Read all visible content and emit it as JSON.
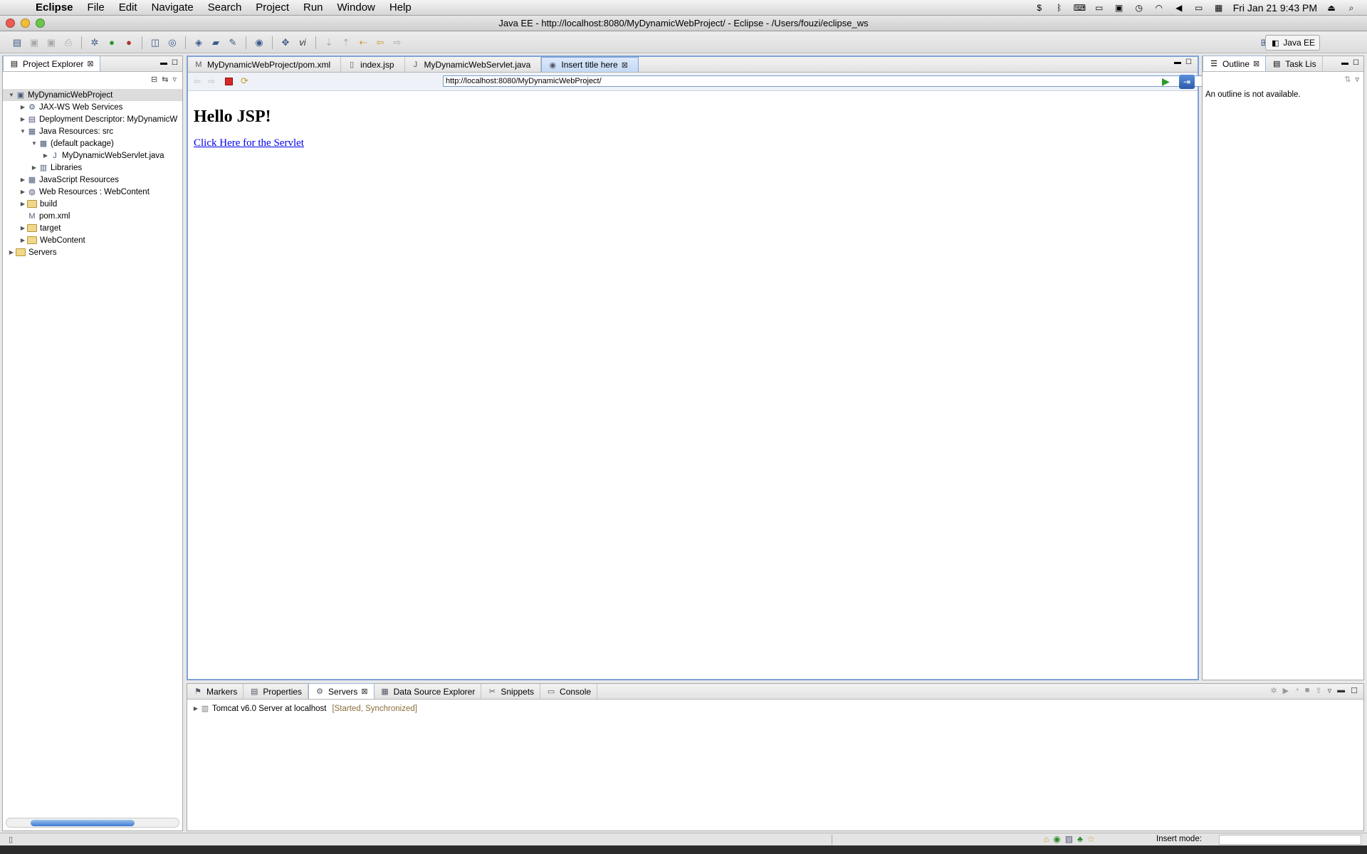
{
  "menubar": {
    "app": "Eclipse",
    "items": [
      "File",
      "Edit",
      "Navigate",
      "Search",
      "Project",
      "Run",
      "Window",
      "Help"
    ],
    "clock": "Fri Jan 21  9:43 PM"
  },
  "window": {
    "title": "Java EE - http://localhost:8080/MyDynamicWebProject/ - Eclipse - /Users/fouzi/eclipse_ws"
  },
  "perspective": {
    "label": "Java EE"
  },
  "project_explorer": {
    "tab_label": "Project Explorer",
    "tree": [
      {
        "label": "MyDynamicWebProject",
        "depth": 0,
        "expander": "open",
        "icon": "project-icon"
      },
      {
        "label": "JAX-WS Web Services",
        "depth": 1,
        "expander": "closed",
        "icon": "webservice-icon"
      },
      {
        "label": "Deployment Descriptor: MyDynamicW",
        "depth": 1,
        "expander": "closed",
        "icon": "descriptor-icon"
      },
      {
        "label": "Java Resources: src",
        "depth": 1,
        "expander": "open",
        "icon": "java-resources-icon"
      },
      {
        "label": "(default package)",
        "depth": 2,
        "expander": "open",
        "icon": "package-icon"
      },
      {
        "label": "MyDynamicWebServlet.java",
        "depth": 3,
        "expander": "closed",
        "icon": "java-file-icon"
      },
      {
        "label": "Libraries",
        "depth": 2,
        "expander": "closed",
        "icon": "libraries-icon"
      },
      {
        "label": "JavaScript Resources",
        "depth": 1,
        "expander": "closed",
        "icon": "js-resources-icon"
      },
      {
        "label": "Web Resources : WebContent",
        "depth": 1,
        "expander": "closed",
        "icon": "web-resources-icon"
      },
      {
        "label": "build",
        "depth": 1,
        "expander": "closed",
        "icon": "folder-icon"
      },
      {
        "label": "pom.xml",
        "depth": 1,
        "expander": "none",
        "icon": "xml-file-icon"
      },
      {
        "label": "target",
        "depth": 1,
        "expander": "closed",
        "icon": "folder-icon"
      },
      {
        "label": "WebContent",
        "depth": 1,
        "expander": "closed",
        "icon": "folder-icon"
      },
      {
        "label": "Servers",
        "depth": 0,
        "expander": "closed",
        "icon": "folder-icon"
      }
    ]
  },
  "editor": {
    "tabs": [
      {
        "label": "MyDynamicWebProject/pom.xml",
        "icon": "xml-file-icon",
        "active": false
      },
      {
        "label": "index.jsp",
        "icon": "jsp-file-icon",
        "active": false
      },
      {
        "label": "MyDynamicWebServlet.java",
        "icon": "java-file-icon",
        "active": false
      },
      {
        "label": "Insert title here",
        "icon": "globe-icon",
        "active": true
      }
    ],
    "url": "http://localhost:8080/MyDynamicWebProject/",
    "page": {
      "heading": "Hello JSP!",
      "link": "Click Here for the Servlet"
    }
  },
  "outline": {
    "tabs": [
      {
        "label": "Outline"
      },
      {
        "label": "Task Lis"
      }
    ],
    "message": "An outline is not available."
  },
  "bottom": {
    "tabs": [
      {
        "label": "Markers",
        "icon": "markers-icon"
      },
      {
        "label": "Properties",
        "icon": "properties-icon"
      },
      {
        "label": "Servers",
        "icon": "servers-icon",
        "active": true
      },
      {
        "label": "Data Source Explorer",
        "icon": "datasource-icon"
      },
      {
        "label": "Snippets",
        "icon": "snippets-icon"
      },
      {
        "label": "Console",
        "icon": "console-icon"
      }
    ],
    "server": {
      "name": "Tomcat v6.0 Server at localhost",
      "state": "[Started, Synchronized]"
    }
  },
  "status": {
    "insert_mode_label": "Insert mode:"
  },
  "colors": {
    "accent": "#7fa2d6",
    "link": "#0000ee",
    "server_state": "#8a6d3b"
  }
}
